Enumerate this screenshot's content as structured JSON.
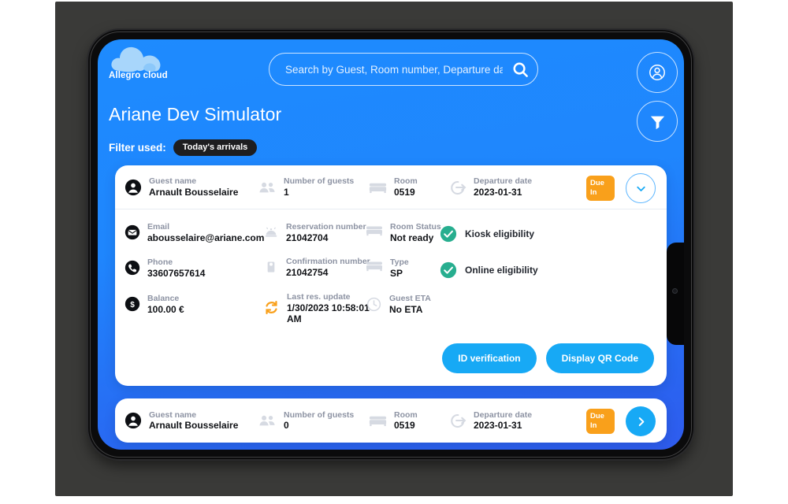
{
  "brand": {
    "name": "Allegro cloud",
    "logo_icon": "cloud-icon"
  },
  "search": {
    "placeholder": "Search by Guest, Room number, Departure date",
    "value": "",
    "icon": "search-icon"
  },
  "header": {
    "title": "Ariane Dev Simulator",
    "account_icon": "account-circle-icon",
    "filter_icon": "filter-funnel-icon"
  },
  "filter": {
    "label": "Filter used:",
    "chip": "Today's arrivals"
  },
  "colors": {
    "accent_blue": "#17a9f5",
    "header_blue": "#1f86fd",
    "bottom_blue": "#2f5cee",
    "badge_orange": "#f9a01b",
    "success_green": "#27ae8f",
    "chip_dark": "#1e1e20"
  },
  "cards": [
    {
      "summary": {
        "guest": {
          "label": "Guest name",
          "value": "Arnault Bousselaire",
          "icon": "person-circle-icon"
        },
        "guests": {
          "label": "Number of guests",
          "value": "1",
          "icon": "people-icon"
        },
        "room": {
          "label": "Room",
          "value": "0519",
          "icon": "bed-icon"
        },
        "departure": {
          "label": "Departure date",
          "value": "2023-01-31",
          "icon": "checkout-arrow-icon"
        },
        "badge": {
          "line1": "Due",
          "line2": "In"
        },
        "toggle_icon": "chevron-down-icon"
      },
      "details": {
        "email": {
          "label": "Email",
          "value": "abousselaire@ariane.com",
          "icon": "envelope-icon"
        },
        "phone": {
          "label": "Phone",
          "value": "33607657614",
          "icon": "phone-icon"
        },
        "balance": {
          "label": "Balance",
          "value": "100.00 €",
          "icon": "dollar-icon"
        },
        "reservation_number": {
          "label": "Reservation number",
          "value": "21042704",
          "icon": "bell-icon"
        },
        "confirmation_number": {
          "label": "Confirmation number",
          "value": "21042754",
          "icon": "door-hanger-icon"
        },
        "last_update": {
          "label": "Last res. update",
          "value": "1/30/2023 10:58:01 AM",
          "icon": "sync-icon"
        },
        "room_status": {
          "label": "Room Status",
          "value": "Not ready",
          "icon": "bed-icon"
        },
        "type": {
          "label": "Type",
          "value": "SP",
          "icon": "bed-icon"
        },
        "guest_eta": {
          "label": "Guest ETA",
          "value": "No ETA",
          "icon": "clock-icon"
        },
        "eligibility": [
          {
            "label": "Kiosk eligibility",
            "icon": "check-circle-icon",
            "state": "ok"
          },
          {
            "label": "Online eligibility",
            "icon": "check-circle-icon",
            "state": "ok"
          }
        ],
        "actions": [
          {
            "label": "ID verification"
          },
          {
            "label": "Display QR Code"
          }
        ]
      }
    },
    {
      "summary": {
        "guest": {
          "label": "Guest name",
          "value": "Arnault Bousselaire",
          "icon": "person-circle-icon"
        },
        "guests": {
          "label": "Number of guests",
          "value": "0",
          "icon": "people-icon"
        },
        "room": {
          "label": "Room",
          "value": "0519",
          "icon": "bed-icon"
        },
        "departure": {
          "label": "Departure date",
          "value": "2023-01-31",
          "icon": "checkout-arrow-icon"
        },
        "badge": {
          "line1": "Due",
          "line2": "In"
        },
        "toggle_icon": "chevron-right-icon"
      }
    }
  ]
}
